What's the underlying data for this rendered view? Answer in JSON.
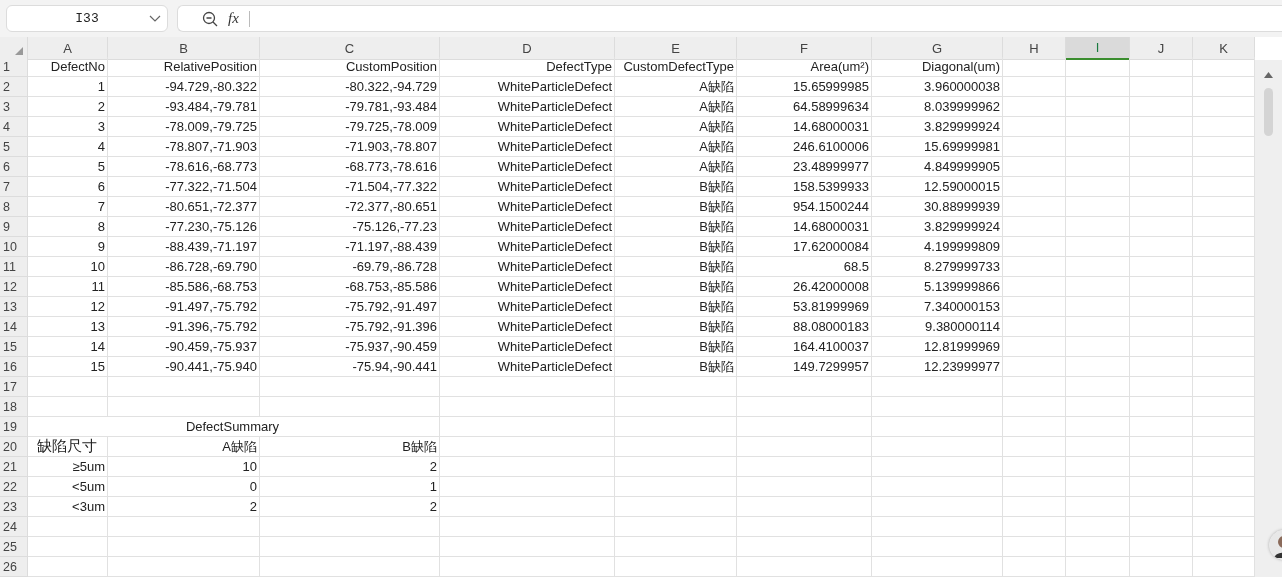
{
  "name_box": {
    "value": "I33"
  },
  "formula_bar": {
    "fx_label": "fx"
  },
  "columns": [
    {
      "label": "A",
      "selected": false
    },
    {
      "label": "B",
      "selected": false
    },
    {
      "label": "C",
      "selected": false
    },
    {
      "label": "D",
      "selected": false
    },
    {
      "label": "E",
      "selected": false
    },
    {
      "label": "F",
      "selected": false
    },
    {
      "label": "G",
      "selected": false
    },
    {
      "label": "H",
      "selected": false
    },
    {
      "label": "I",
      "selected": true
    },
    {
      "label": "J",
      "selected": false
    },
    {
      "label": "K",
      "selected": false
    }
  ],
  "rows": [
    {
      "number": "1",
      "kind": "data",
      "cells": [
        "DefectNo",
        "RelativePosition",
        "CustomPosition",
        "DefectType",
        "CustomDefectType",
        "Area(um²)",
        "Diagonal(um)"
      ]
    },
    {
      "number": "2",
      "kind": "data",
      "cells": [
        "1",
        "-94.729,-80.322",
        "-80.322,-94.729",
        "WhiteParticleDefect",
        "A缺陷",
        "15.65999985",
        "3.960000038"
      ]
    },
    {
      "number": "3",
      "kind": "data",
      "cells": [
        "2",
        "-93.484,-79.781",
        "-79.781,-93.484",
        "WhiteParticleDefect",
        "A缺陷",
        "64.58999634",
        "8.039999962"
      ]
    },
    {
      "number": "4",
      "kind": "data",
      "cells": [
        "3",
        "-78.009,-79.725",
        "-79.725,-78.009",
        "WhiteParticleDefect",
        "A缺陷",
        "14.68000031",
        "3.829999924"
      ]
    },
    {
      "number": "5",
      "kind": "data",
      "cells": [
        "4",
        "-78.807,-71.903",
        "-71.903,-78.807",
        "WhiteParticleDefect",
        "A缺陷",
        "246.6100006",
        "15.69999981"
      ]
    },
    {
      "number": "6",
      "kind": "data",
      "cells": [
        "5",
        "-78.616,-68.773",
        "-68.773,-78.616",
        "WhiteParticleDefect",
        "A缺陷",
        "23.48999977",
        "4.849999905"
      ]
    },
    {
      "number": "7",
      "kind": "data",
      "cells": [
        "6",
        "-77.322,-71.504",
        "-71.504,-77.322",
        "WhiteParticleDefect",
        "B缺陷",
        "158.5399933",
        "12.59000015"
      ]
    },
    {
      "number": "8",
      "kind": "data",
      "cells": [
        "7",
        "-80.651,-72.377",
        "-72.377,-80.651",
        "WhiteParticleDefect",
        "B缺陷",
        "954.1500244",
        "30.88999939"
      ]
    },
    {
      "number": "9",
      "kind": "data",
      "cells": [
        "8",
        "-77.230,-75.126",
        "-75.126,-77.23",
        "WhiteParticleDefect",
        "B缺陷",
        "14.68000031",
        "3.829999924"
      ]
    },
    {
      "number": "10",
      "kind": "data",
      "cells": [
        "9",
        "-88.439,-71.197",
        "-71.197,-88.439",
        "WhiteParticleDefect",
        "B缺陷",
        "17.62000084",
        "4.199999809"
      ]
    },
    {
      "number": "11",
      "kind": "data",
      "cells": [
        "10",
        "-86.728,-69.790",
        "-69.79,-86.728",
        "WhiteParticleDefect",
        "B缺陷",
        "68.5",
        "8.279999733"
      ]
    },
    {
      "number": "12",
      "kind": "data",
      "cells": [
        "11",
        "-85.586,-68.753",
        "-68.753,-85.586",
        "WhiteParticleDefect",
        "B缺陷",
        "26.42000008",
        "5.139999866"
      ]
    },
    {
      "number": "13",
      "kind": "data",
      "cells": [
        "12",
        "-91.497,-75.792",
        "-75.792,-91.497",
        "WhiteParticleDefect",
        "B缺陷",
        "53.81999969",
        "7.340000153"
      ]
    },
    {
      "number": "14",
      "kind": "data",
      "cells": [
        "13",
        "-91.396,-75.792",
        "-75.792,-91.396",
        "WhiteParticleDefect",
        "B缺陷",
        "88.08000183",
        "9.380000114"
      ]
    },
    {
      "number": "15",
      "kind": "data",
      "cells": [
        "14",
        "-90.459,-75.937",
        "-75.937,-90.459",
        "WhiteParticleDefect",
        "B缺陷",
        "164.4100037",
        "12.81999969"
      ]
    },
    {
      "number": "16",
      "kind": "data",
      "cells": [
        "15",
        "-90.441,-75.940",
        "-75.94,-90.441",
        "WhiteParticleDefect",
        "B缺陷",
        "149.7299957",
        "12.23999977"
      ]
    },
    {
      "number": "17",
      "kind": "blank"
    },
    {
      "number": "18",
      "kind": "blank"
    },
    {
      "number": "19",
      "kind": "title",
      "text": "DefectSummary"
    },
    {
      "number": "20",
      "kind": "summary_header",
      "cells": [
        "缺陷尺寸",
        "A缺陷",
        "B缺陷"
      ]
    },
    {
      "number": "21",
      "kind": "summary",
      "cells": [
        "≥5um",
        "10",
        "2"
      ]
    },
    {
      "number": "22",
      "kind": "summary",
      "cells": [
        "<5um",
        "0",
        "1"
      ]
    },
    {
      "number": "23",
      "kind": "summary",
      "cells": [
        "<3um",
        "2",
        "2"
      ]
    },
    {
      "number": "24",
      "kind": "blank"
    },
    {
      "number": "25",
      "kind": "blank"
    },
    {
      "number": "26",
      "kind": "blank"
    }
  ]
}
